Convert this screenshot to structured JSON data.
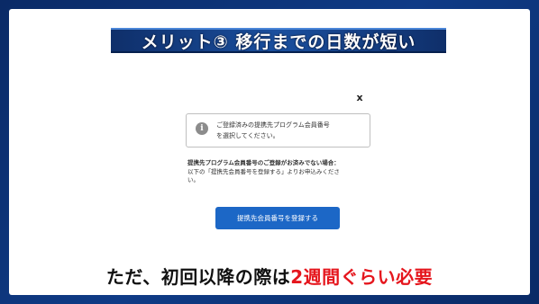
{
  "slide": {
    "title": "メリット③ 移行までの日数が短い",
    "caption_prefix": "ただ、初回以降の際は",
    "caption_highlight": "2週間ぐらい必要"
  },
  "dialog": {
    "close_label": "x",
    "info_icon": "i",
    "info_line1": "ご登録済みの提携先プログラム会員番号",
    "info_line2": "を選択してください。",
    "notice_bold": "提携先プログラム会員番号のご登録がお済みでない場合：",
    "notice_line1": "以下の「提携先会員番号を登録する」よりお申込みくださ",
    "notice_line2": "い。",
    "register_button": "提携先会員番号を登録する"
  },
  "colors": {
    "banner": "#1a4f9e",
    "button": "#1c67c6",
    "highlight": "#e5161d"
  }
}
